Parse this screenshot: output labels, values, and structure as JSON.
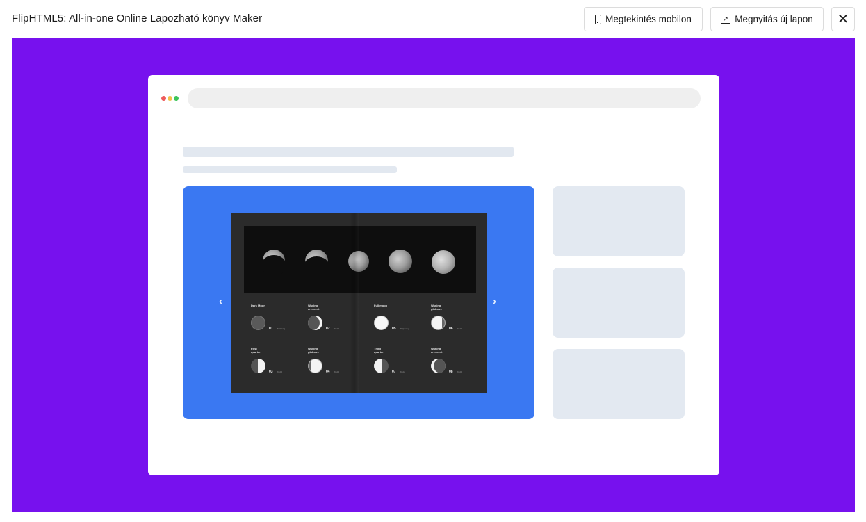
{
  "header": {
    "title": "FlipHTML5: All-in-one Online Lapozható könyv Maker",
    "buttons": {
      "view_mobile": "Megtekintés mobilon",
      "open_new_tab": "Megnyitás új lapon",
      "close": "✕"
    }
  },
  "colors": {
    "stage_background": "#7711ee",
    "viewer_background": "#3a78f2",
    "skeleton": "#e2e8f0"
  },
  "viewer": {
    "prev_arrow": "‹",
    "next_arrow": "›"
  },
  "book": {
    "phases": [
      {
        "name": "Dark Moon",
        "num": "01",
        "sub": "Mélység"
      },
      {
        "name": "Waxing crescent",
        "num": "02",
        "sub": "Kezd"
      },
      {
        "name": "Full moon",
        "num": "05",
        "sub": "Teljesség"
      },
      {
        "name": "Waning gibbous",
        "num": "06",
        "sub": "Kezd"
      },
      {
        "name": "First quarter",
        "num": "03",
        "sub": "Kezd"
      },
      {
        "name": "Waxing gibbous",
        "num": "04",
        "sub": "Kezd"
      },
      {
        "name": "Third quarter",
        "num": "07",
        "sub": "Kezd"
      },
      {
        "name": "Waning crescent",
        "num": "08",
        "sub": "Kezd"
      }
    ]
  }
}
